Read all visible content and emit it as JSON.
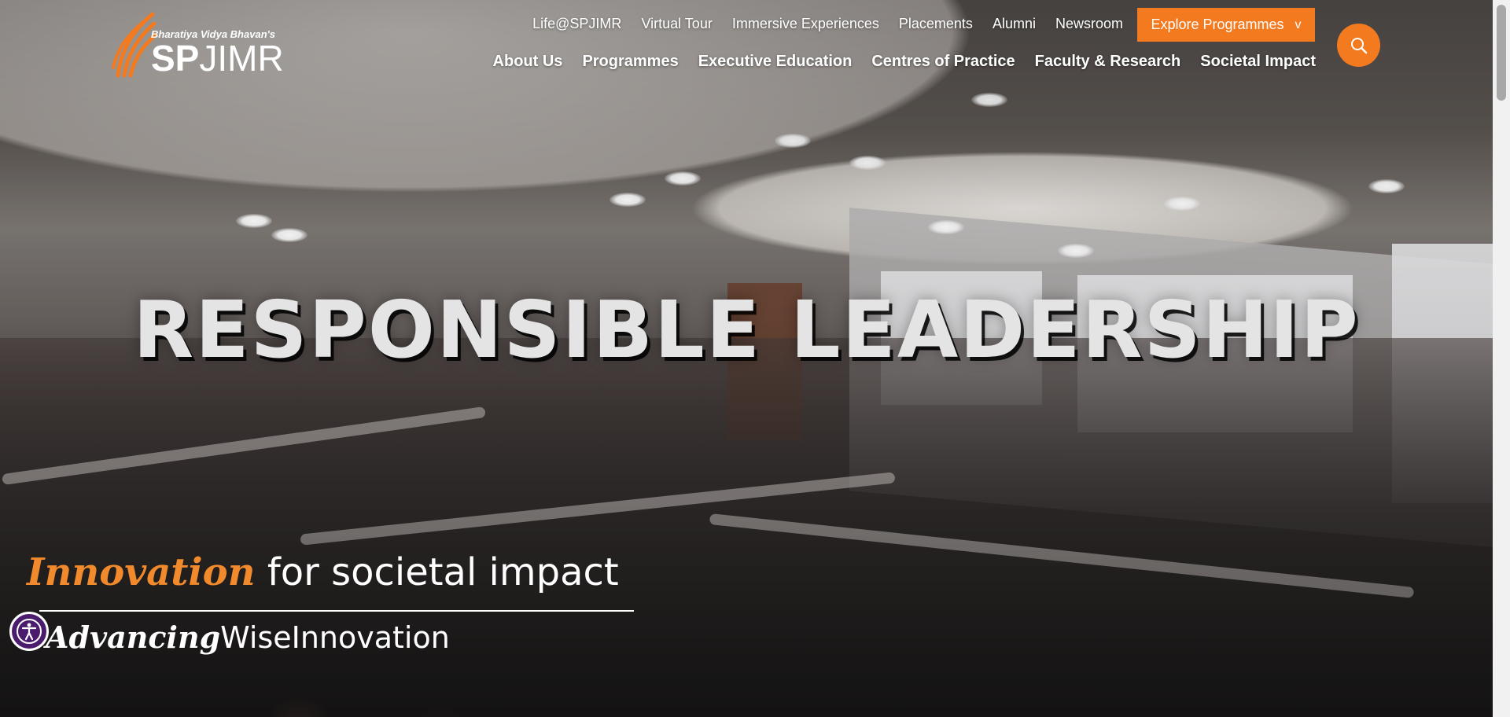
{
  "brand": {
    "tagline_top": "Bharatiya Vidya Bhavan's",
    "name_bold": "SP",
    "name_regular": "JIMR",
    "accent_color": "#f47a20"
  },
  "utility_nav": [
    {
      "label": "Life@SPJIMR"
    },
    {
      "label": "Virtual Tour"
    },
    {
      "label": "Immersive Experiences"
    },
    {
      "label": "Placements"
    },
    {
      "label": "Alumni"
    },
    {
      "label": "Newsroom"
    }
  ],
  "explore_button": {
    "label": "Explore Programmes",
    "chevron": "v"
  },
  "search": {
    "icon": "search-icon"
  },
  "main_nav": [
    {
      "label": "About Us"
    },
    {
      "label": "Programmes"
    },
    {
      "label": "Executive Education"
    },
    {
      "label": "Centres of Practice"
    },
    {
      "label": "Faculty & Research"
    },
    {
      "label": "Societal Impact"
    }
  ],
  "hero": {
    "heading": "RESPONSIBLE LEADERSHIP",
    "tagline_accent": "Innovation",
    "tagline_rest": " for societal impact",
    "subline_emphasis": "Advancing",
    "subline_rest": "WiseInnovation"
  },
  "accessibility": {
    "icon": "accessibility-icon"
  }
}
